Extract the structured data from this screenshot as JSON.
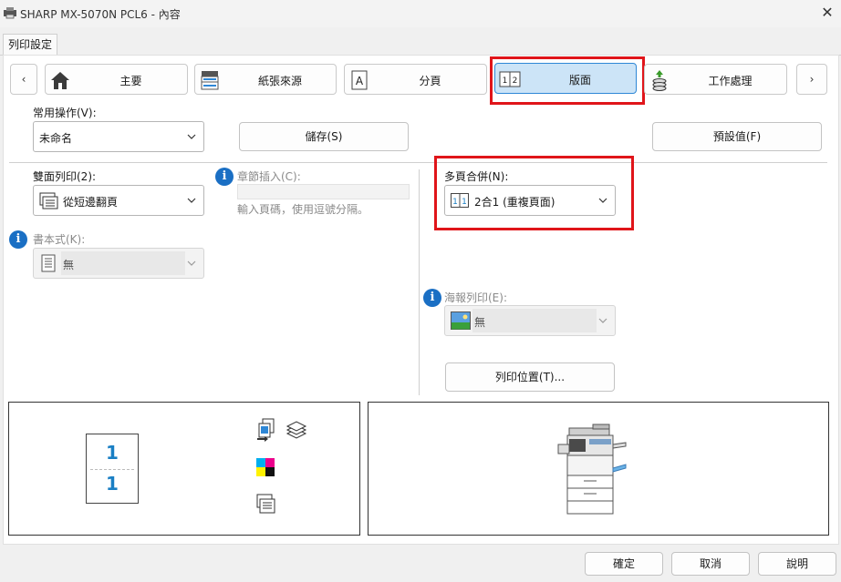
{
  "window": {
    "title": "SHARP MX-5070N PCL6 - 內容",
    "close_glyph": "✕"
  },
  "outer_tab": "列印設定",
  "nav": {
    "prev": "‹",
    "next": "›",
    "tabs": [
      {
        "label": "主要",
        "icon": "home-icon"
      },
      {
        "label": "紙張來源",
        "icon": "paper-tray-icon"
      },
      {
        "label": "分頁",
        "icon": "page-a-icon"
      },
      {
        "label": "版面",
        "icon": "layout-1-2-icon",
        "active": true
      },
      {
        "label": "工作處理",
        "icon": "job-handling-icon"
      }
    ]
  },
  "common": {
    "label": "常用操作(V):",
    "value": "未命名",
    "save": "儲存(S)",
    "defaults": "預設值(F)"
  },
  "duplex": {
    "label": "雙面列印(2):",
    "value": "從短邊翻頁"
  },
  "chapter": {
    "label": "章節插入(C):",
    "hint": "輸入頁碼，使用逗號分隔。",
    "value": ""
  },
  "booklet": {
    "label": "書本式(K):",
    "value": "無"
  },
  "nup": {
    "label": "多頁合併(N):",
    "value": "2合1 (重複頁面)"
  },
  "poster": {
    "label": "海報列印(E):",
    "value": "無"
  },
  "print_position": "列印位置(T)...",
  "preview": {
    "digit_top": "1",
    "digit_bottom": "1"
  },
  "footer": {
    "ok": "確定",
    "cancel": "取消",
    "help": "說明"
  },
  "colors": {
    "accent": "#2e87d6",
    "highlight": "#e0151a",
    "info": "#1a6fc4",
    "preview_digit": "#1a7fc4"
  }
}
